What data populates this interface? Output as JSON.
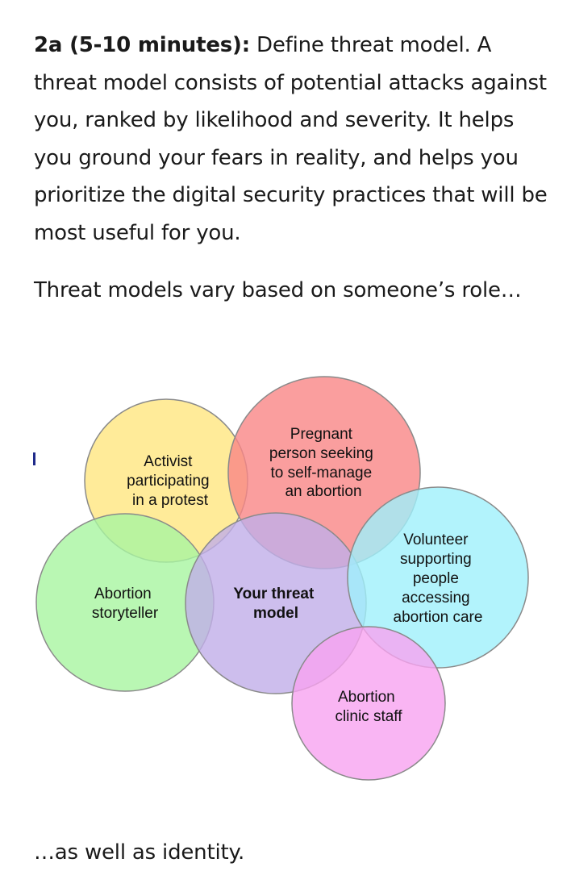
{
  "intro": {
    "heading": "2a (5-10 minutes):",
    "body": " Define threat model. A threat model consists of potential attacks against you, ranked by likelihood and severity. It helps you ground your fears in reality, and helps you prioritize the digital security practices that will be most useful for you."
  },
  "role_line": "Threat models vary based on someone’s role…",
  "diagram": {
    "center_label": [
      "Your threat",
      "model"
    ],
    "circles": [
      {
        "id": "activist",
        "color": "#ffe680",
        "lines": [
          "Activist",
          "participating",
          "in a protest"
        ]
      },
      {
        "id": "pregnant",
        "color": "#f98686",
        "lines": [
          "Pregnant",
          "person seeking",
          "to self-manage",
          "an abortion"
        ]
      },
      {
        "id": "storyteller",
        "color": "#a8f5a0",
        "lines": [
          "Abortion",
          "storyteller"
        ]
      },
      {
        "id": "volunteer",
        "color": "#9ff0fb",
        "lines": [
          "Volunteer",
          "supporting",
          "people",
          "accessing",
          "abortion care"
        ]
      },
      {
        "id": "clinic",
        "color": "#f8a2f0",
        "lines": [
          "Abortion",
          "clinic staff"
        ]
      }
    ],
    "center_color": "#c1aee9"
  },
  "outro": "…as well as identity."
}
